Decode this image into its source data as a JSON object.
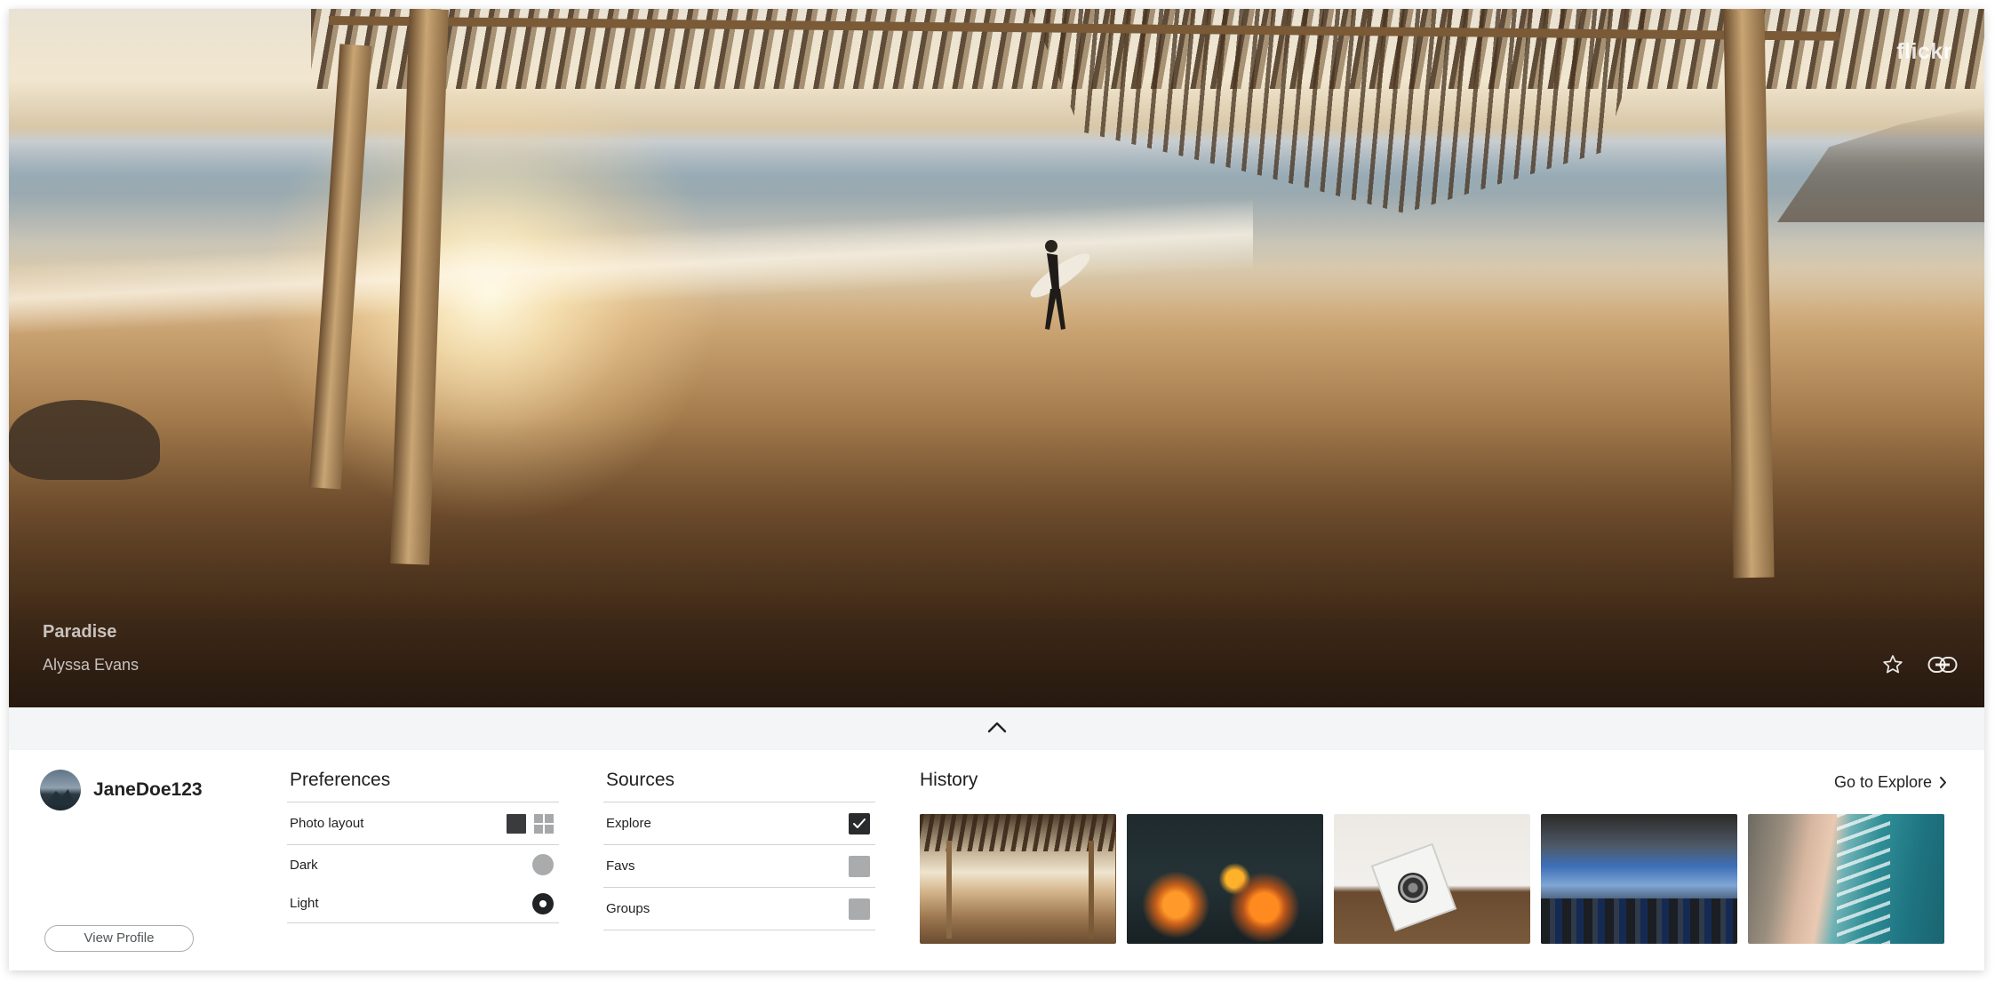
{
  "brand": {
    "logo_text": "flickr"
  },
  "photo": {
    "title": "Paradise",
    "author": "Alyssa Evans",
    "actions": [
      "star-icon",
      "link-icon"
    ]
  },
  "collapse": {
    "icon": "chevron-up-icon"
  },
  "profile": {
    "username": "JaneDoe123",
    "view_profile_label": "View Profile"
  },
  "preferences": {
    "title": "Preferences",
    "photo_layout_label": "Photo layout",
    "photo_layout_selected": "single",
    "themes": [
      {
        "label": "Dark",
        "selected": false
      },
      {
        "label": "Light",
        "selected": true
      }
    ]
  },
  "sources": {
    "title": "Sources",
    "items": [
      {
        "label": "Explore",
        "checked": true
      },
      {
        "label": "Favs",
        "checked": false
      },
      {
        "label": "Groups",
        "checked": false
      }
    ]
  },
  "history": {
    "title": "History",
    "go_to_label": "Go to Explore",
    "thumbnails": [
      {
        "name": "beach-hut-thumbnail"
      },
      {
        "name": "marshmallow-fire-thumbnail"
      },
      {
        "name": "speaker-desk-thumbnail"
      },
      {
        "name": "street-crowd-thumbnail"
      },
      {
        "name": "aerial-coast-thumbnail"
      }
    ]
  },
  "colors": {
    "panel_bg": "#ffffff",
    "collapse_bar_bg": "#f3f5f6",
    "text": "#212124",
    "divider": "#cfd3d6"
  }
}
